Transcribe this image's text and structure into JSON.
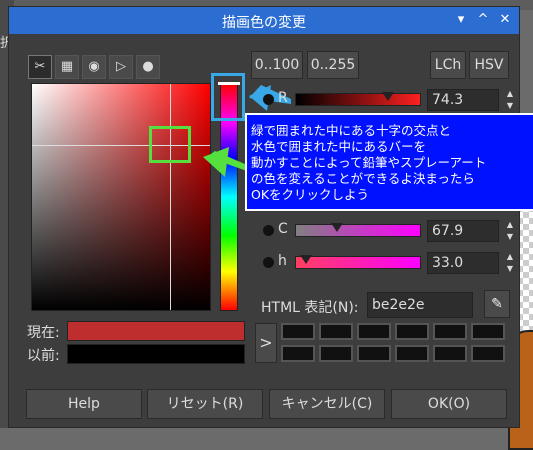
{
  "background": {
    "left_text": "択"
  },
  "window": {
    "title": "描画色の変更",
    "controls": [
      "▾",
      "^",
      "✕"
    ]
  },
  "mode_tabs": [
    "gimp-icon",
    "cmyk-icon",
    "watercolor-icon",
    "triangle-icon",
    "palette-icon"
  ],
  "scale_buttons": [
    "0..100",
    "0..255"
  ],
  "space_buttons": [
    "LCh",
    "HSV"
  ],
  "channels": [
    {
      "label": "R",
      "value": "74.3",
      "marker": 0.74,
      "colors": [
        "#000000",
        "#ff2020"
      ]
    },
    {
      "label": "C",
      "value": "67.9",
      "marker": 0.33,
      "colors": [
        "#808080",
        "#ff00ff"
      ]
    },
    {
      "label": "h",
      "value": "33.0",
      "marker": 0.09,
      "colors": [
        "#ff4060",
        "#ff00ff"
      ]
    }
  ],
  "annotation": {
    "lines": [
      "緑で囲まれた中にある十字の交点と",
      "水色で囲まれた中にあるバーを",
      "動かすことによって鉛筆やスプレーアート",
      "の色を変えることができるよ決まったら",
      "OKをクリックしよう"
    ]
  },
  "html_notation": {
    "label": "HTML 表記(N):",
    "value": "be2e2e"
  },
  "current": {
    "label": "現在:",
    "color": "#be2e2e"
  },
  "previous": {
    "label": "以前:",
    "color": "#000000"
  },
  "history_arrow": ">",
  "buttons": {
    "help": "Help",
    "reset": "リセット(R)",
    "cancel": "キャンセル(C)",
    "ok": "OK(O)"
  },
  "colors": {
    "titlebar": "#2b6dd1",
    "green_highlight": "#55e040",
    "blue_highlight": "#39a8e6",
    "annotation_bg": "#0011ff"
  }
}
